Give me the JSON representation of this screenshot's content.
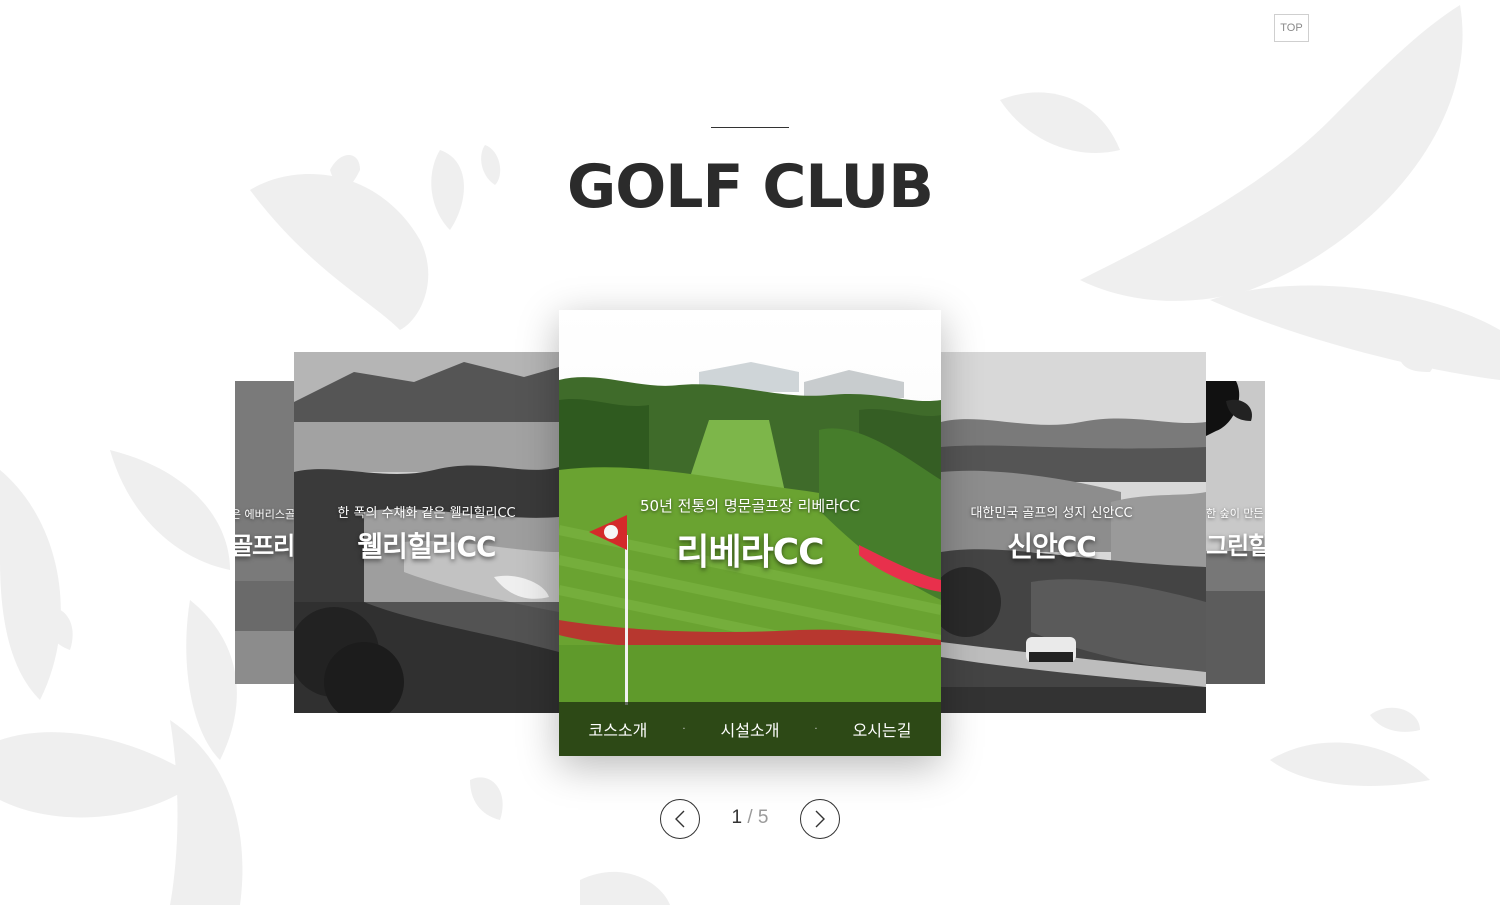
{
  "top_button": {
    "label": "TOP"
  },
  "header": {
    "title": "GOLF CLUB"
  },
  "clubs": [
    {
      "subtitle": "은 에버리스골",
      "name": "골프리"
    },
    {
      "subtitle": "한 폭의 수채화 같은 웰리힐리CC",
      "name": "웰리힐리CC"
    },
    {
      "subtitle": "50년 전통의 명문골프장 리베라CC",
      "name": "리베라CC"
    },
    {
      "subtitle": "대한민국 골프의 성지 신안CC",
      "name": "신안CC"
    },
    {
      "subtitle": "한 숲이 만든",
      "name": "그린힐"
    }
  ],
  "active_card": {
    "links": [
      "코스소개",
      "시설소개",
      "오시는길"
    ],
    "separator": "·"
  },
  "pagination": {
    "current": "1",
    "separator": "/",
    "total": "5"
  },
  "icons": {
    "top": "top-icon",
    "prev": "chevron-left-icon",
    "next": "chevron-right-icon",
    "flag": "golf-flag-icon"
  },
  "colors": {
    "background": "#ffffff",
    "title": "#2b2b2b",
    "decoration": "#eeeeee",
    "flag": "#d42a2a",
    "fairway": "#6aa331"
  }
}
